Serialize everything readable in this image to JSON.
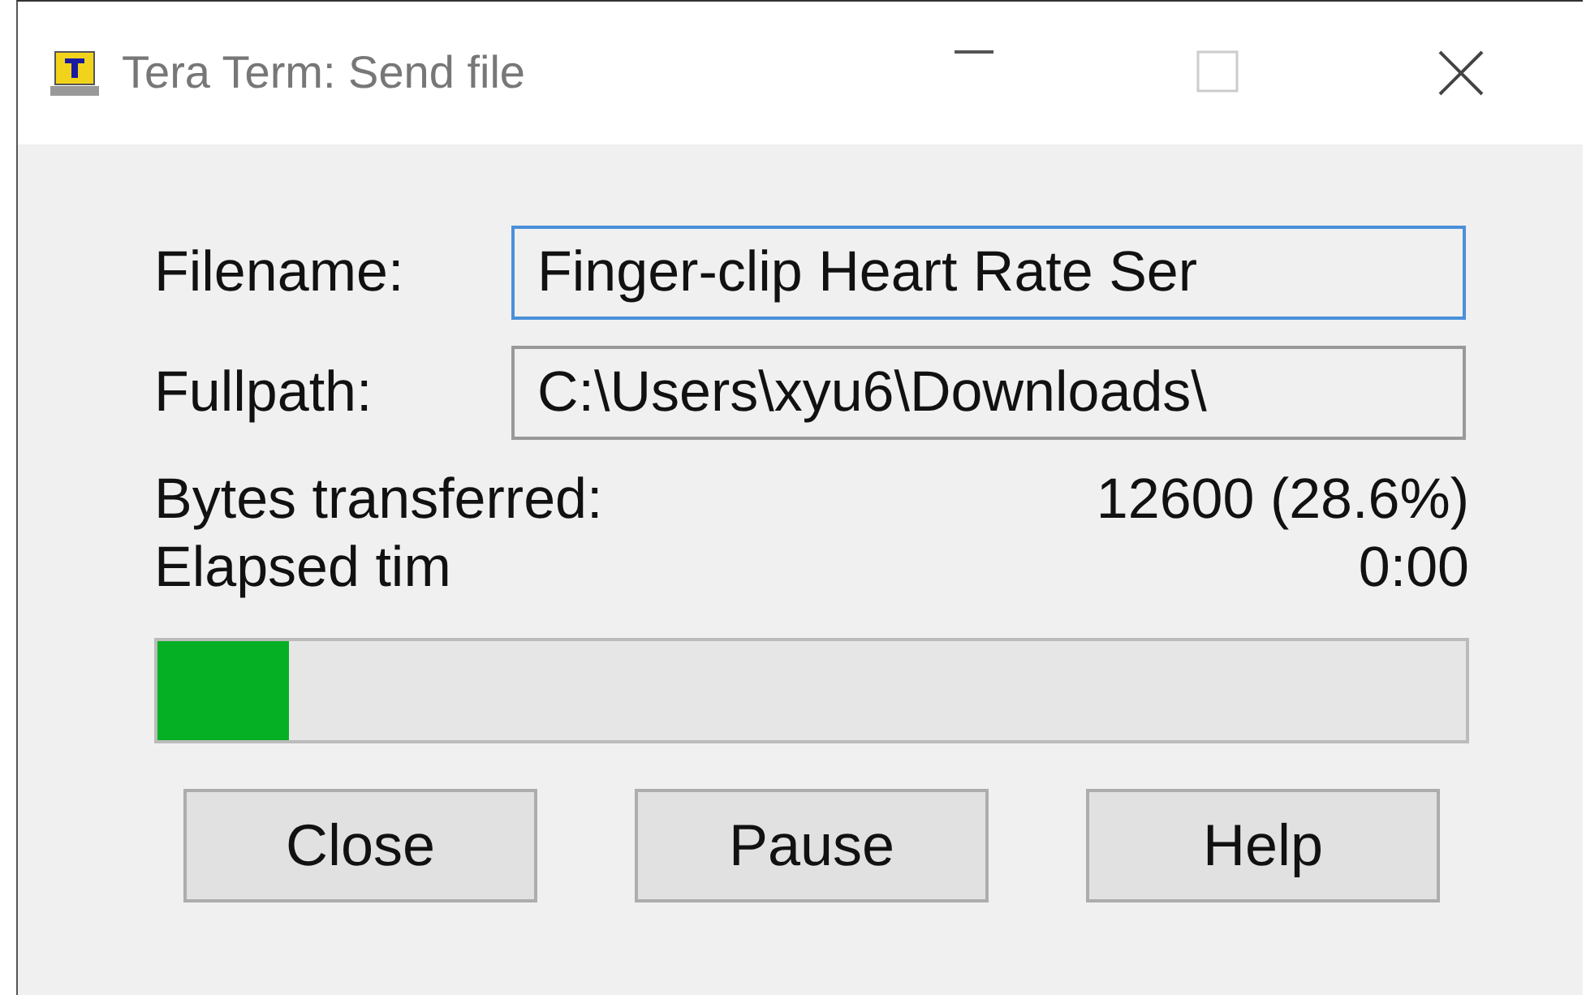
{
  "window": {
    "title": "Tera Term: Send file"
  },
  "fields": [
    {
      "label": "Filename:",
      "value": "Finger-clip Heart Rate Ser",
      "focused": true
    },
    {
      "label": "Fullpath:",
      "value": "C:\\Users\\xyu6\\Downloads\\",
      "focused": false
    }
  ],
  "stats": [
    {
      "label": "Bytes transferred:",
      "value": "12600 (28.6%)"
    },
    {
      "label": "Elapsed tim",
      "value": "0:00"
    }
  ],
  "progress": {
    "level": 0.1
  },
  "buttons": [
    "Close",
    "Pause",
    "Help"
  ]
}
